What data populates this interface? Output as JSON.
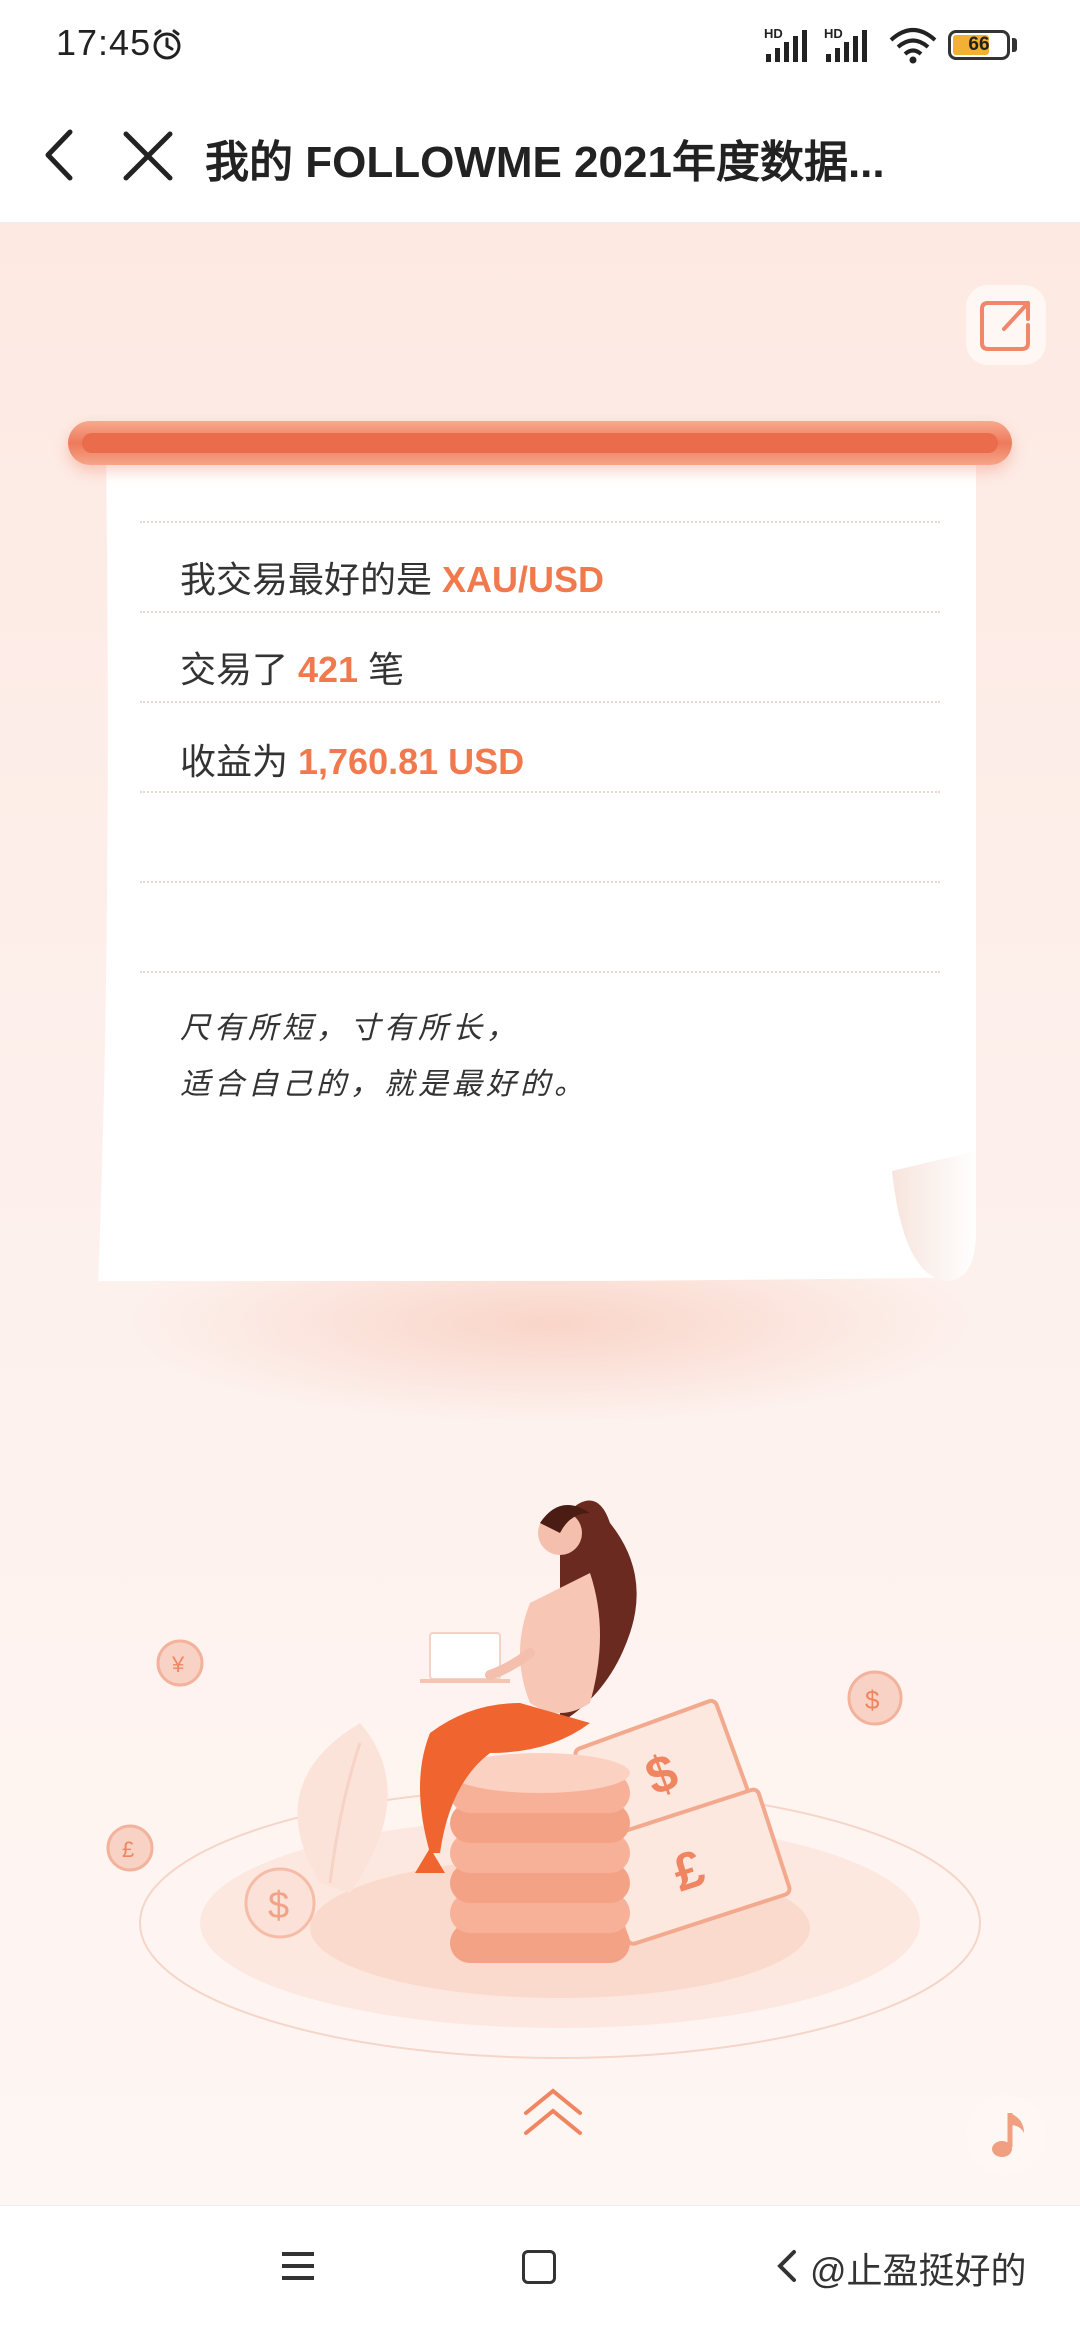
{
  "status_bar": {
    "time": "17:45",
    "battery": "66",
    "signal_label": "HD"
  },
  "nav": {
    "title": "我的 FOLLOWME 2021年度数据..."
  },
  "card": {
    "line1_prefix": "我交易最好的是 ",
    "line1_value": "XAU/USD",
    "line2_prefix": "交易了 ",
    "line2_value": "421",
    "line2_suffix": " 笔",
    "line3_prefix": "收益为 ",
    "line3_value": "1,760.81 USD",
    "quote_line1": "尺有所短，寸有所长，",
    "quote_line2": "适合自己的，就是最好的。"
  },
  "watermark": "@止盈挺好的",
  "icons": [
    "back-arrow-icon",
    "close-icon",
    "share-icon",
    "music-note-icon",
    "chevron-up-icon",
    "menu-icon",
    "home-icon",
    "back-icon"
  ],
  "colors": {
    "accent": "#f07a4e",
    "bar": "#ee7a5b",
    "background": "#fde9e2"
  }
}
